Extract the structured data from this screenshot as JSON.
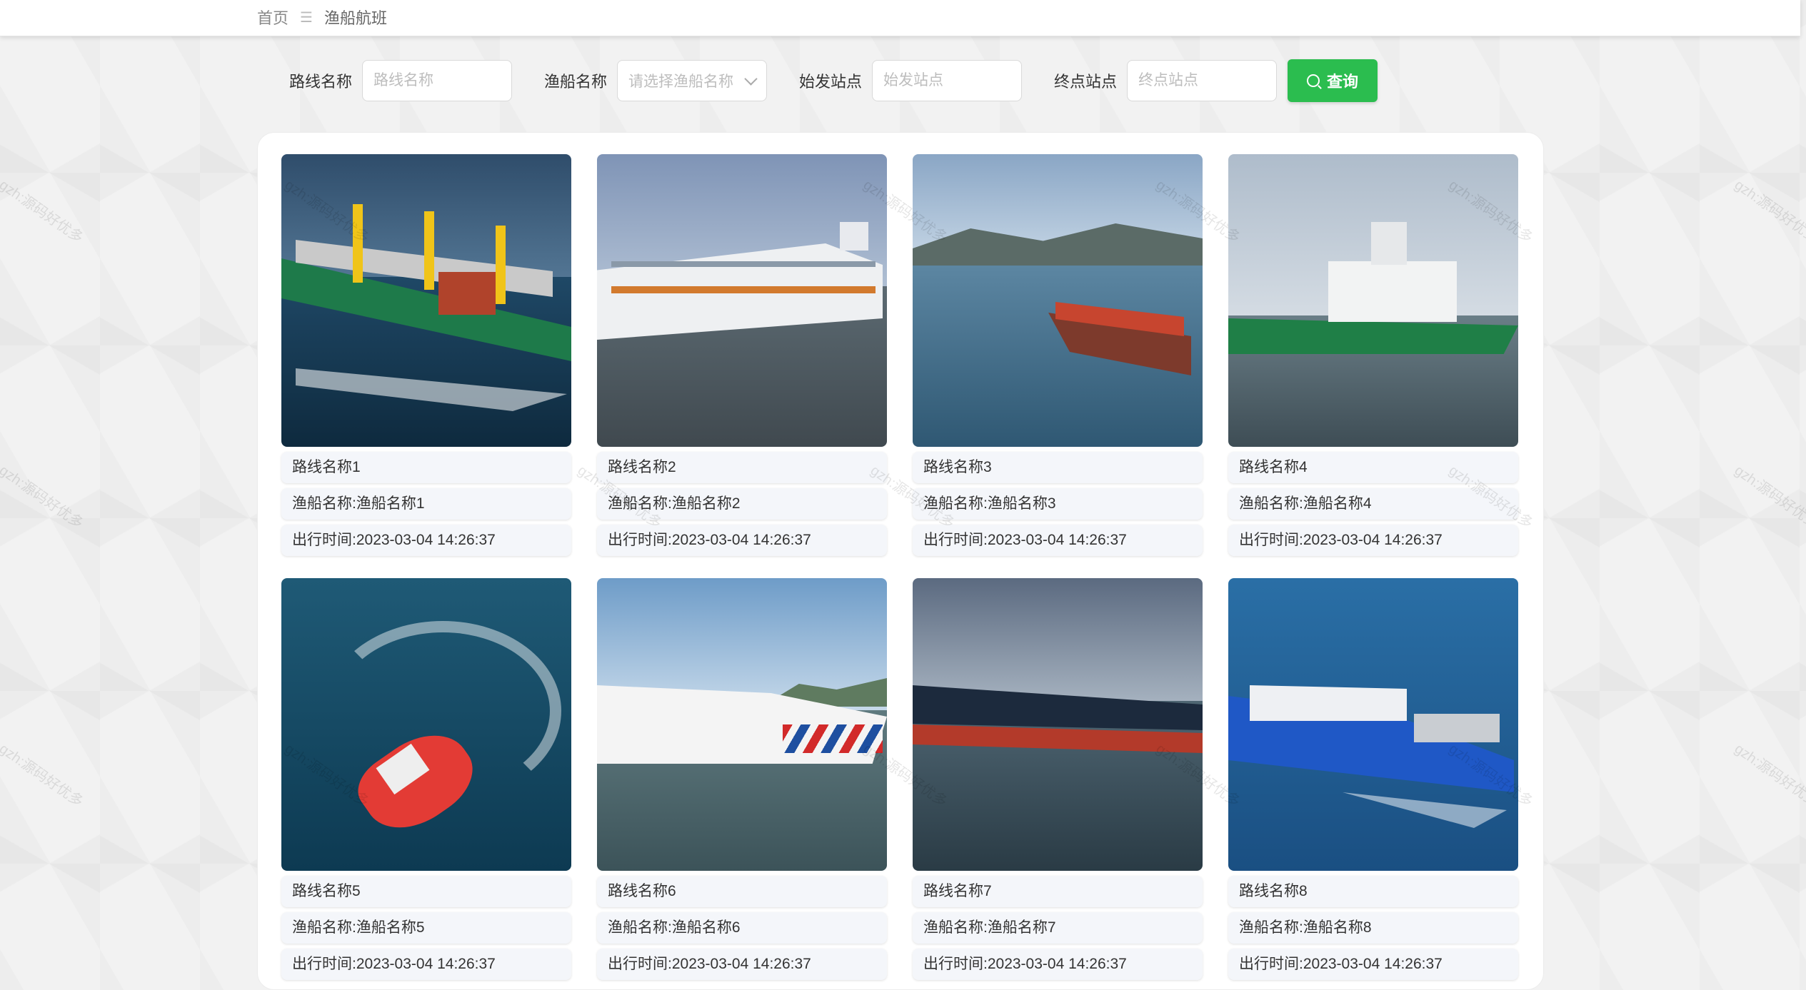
{
  "breadcrumb": {
    "home": "首页",
    "separator": "☰",
    "current": "渔船航班"
  },
  "search": {
    "route_label": "路线名称",
    "route_placeholder": "路线名称",
    "boat_label": "渔船名称",
    "boat_placeholder": "请选择渔船名称",
    "start_label": "始发站点",
    "start_placeholder": "始发站点",
    "end_label": "终点站点",
    "end_placeholder": "终点站点",
    "query_label": "查询",
    "icon": "search-icon"
  },
  "watermark": "gzh:源码好优多",
  "cards": [
    {
      "route": "路线名称1",
      "boat": "渔船名称:渔船名称1",
      "time": "出行时间:2023-03-04 14:26:37",
      "image": "cargo-ship-green"
    },
    {
      "route": "路线名称2",
      "boat": "渔船名称:渔船名称2",
      "time": "出行时间:2023-03-04 14:26:37",
      "image": "cruise-ship"
    },
    {
      "route": "路线名称3",
      "boat": "渔船名称:渔船名称3",
      "time": "出行时间:2023-03-04 14:26:37",
      "image": "container-ship-coast"
    },
    {
      "route": "路线名称4",
      "boat": "渔船名称:渔船名称4",
      "time": "出行时间:2023-03-04 14:26:37",
      "image": "supply-vessel-green"
    },
    {
      "route": "路线名称5",
      "boat": "渔船名称:渔船名称5",
      "time": "出行时间:2023-03-04 14:26:37",
      "image": "red-ship-turning"
    },
    {
      "route": "路线名称6",
      "boat": "渔船名称:渔船名称6",
      "time": "出行时间:2023-03-04 14:26:37",
      "image": "white-patrol-ship"
    },
    {
      "route": "路线名称7",
      "boat": "渔船名称:渔船名称7",
      "time": "出行时间:2023-03-04 14:26:37",
      "image": "lpg-tanker"
    },
    {
      "route": "路线名称8",
      "boat": "渔船名称:渔船名称8",
      "time": "出行时间:2023-03-04 14:26:37",
      "image": "blue-catamaran"
    }
  ]
}
